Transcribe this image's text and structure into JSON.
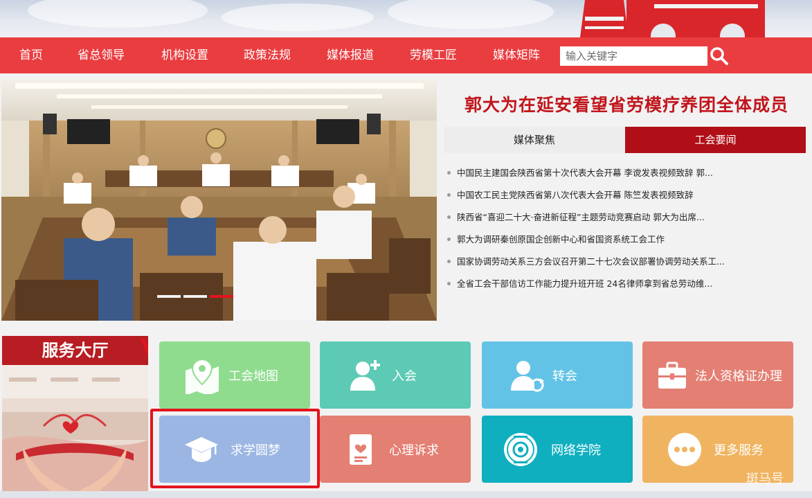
{
  "nav": {
    "items": [
      {
        "label": "首页"
      },
      {
        "label": "省总领导"
      },
      {
        "label": "机构设置"
      },
      {
        "label": "政策法规"
      },
      {
        "label": "媒体报道"
      },
      {
        "label": "劳模工匠"
      },
      {
        "label": "媒体矩阵"
      }
    ]
  },
  "search": {
    "placeholder": "输入关键字",
    "icon": "search-icon"
  },
  "news": {
    "headline": "郭大为在延安看望省劳模疗养团全体成员",
    "tabs": [
      {
        "label": "媒体聚焦",
        "active": false
      },
      {
        "label": "工会要闻",
        "active": true
      }
    ],
    "items": [
      {
        "text": "中国民主建国会陕西省第十次代表大会开幕 李谠发表视频致辞 郭..."
      },
      {
        "text": "中国农工民主党陕西省第八次代表大会开幕 陈竺发表视频致辞"
      },
      {
        "text": "陕西省“喜迎二十大·奋进新征程”主题劳动竞赛启动 郭大为出席..."
      },
      {
        "text": "郭大为调研秦创原国企创新中心和省国资系统工会工作"
      },
      {
        "text": "国家协调劳动关系三方会议召开第二十七次会议部署协调劳动关系工..."
      },
      {
        "text": "全省工会干部信访工作能力提升班开班 24名律师拿到省总劳动维..."
      }
    ]
  },
  "service": {
    "title": "服务大厅",
    "tiles": [
      {
        "label": "工会地图",
        "icon": "map-pin-icon",
        "color": "#8fdc8f"
      },
      {
        "label": "入会",
        "icon": "add-user-icon",
        "color": "#5ccab4"
      },
      {
        "label": "转会",
        "icon": "transfer-user-icon",
        "color": "#63c3e6"
      },
      {
        "label": "法人资格证办理",
        "icon": "briefcase-icon",
        "color": "#e47f73"
      },
      {
        "label": "求学圆梦",
        "icon": "graduation-cap-icon",
        "color": "#9bb6e3"
      },
      {
        "label": "心理诉求",
        "icon": "heart-document-icon",
        "color": "#e47f73"
      },
      {
        "label": "网络学院",
        "icon": "academy-seal-icon",
        "color": "#0fafc0"
      },
      {
        "label": "更多服务",
        "icon": "more-dots-icon",
        "color": "#f0b460"
      }
    ]
  },
  "watermark": "斑马号",
  "colors": {
    "nav": "#ea3d40",
    "headline": "#c1151c",
    "tab_active": "#b10f18",
    "highlight": "#e3141d"
  }
}
